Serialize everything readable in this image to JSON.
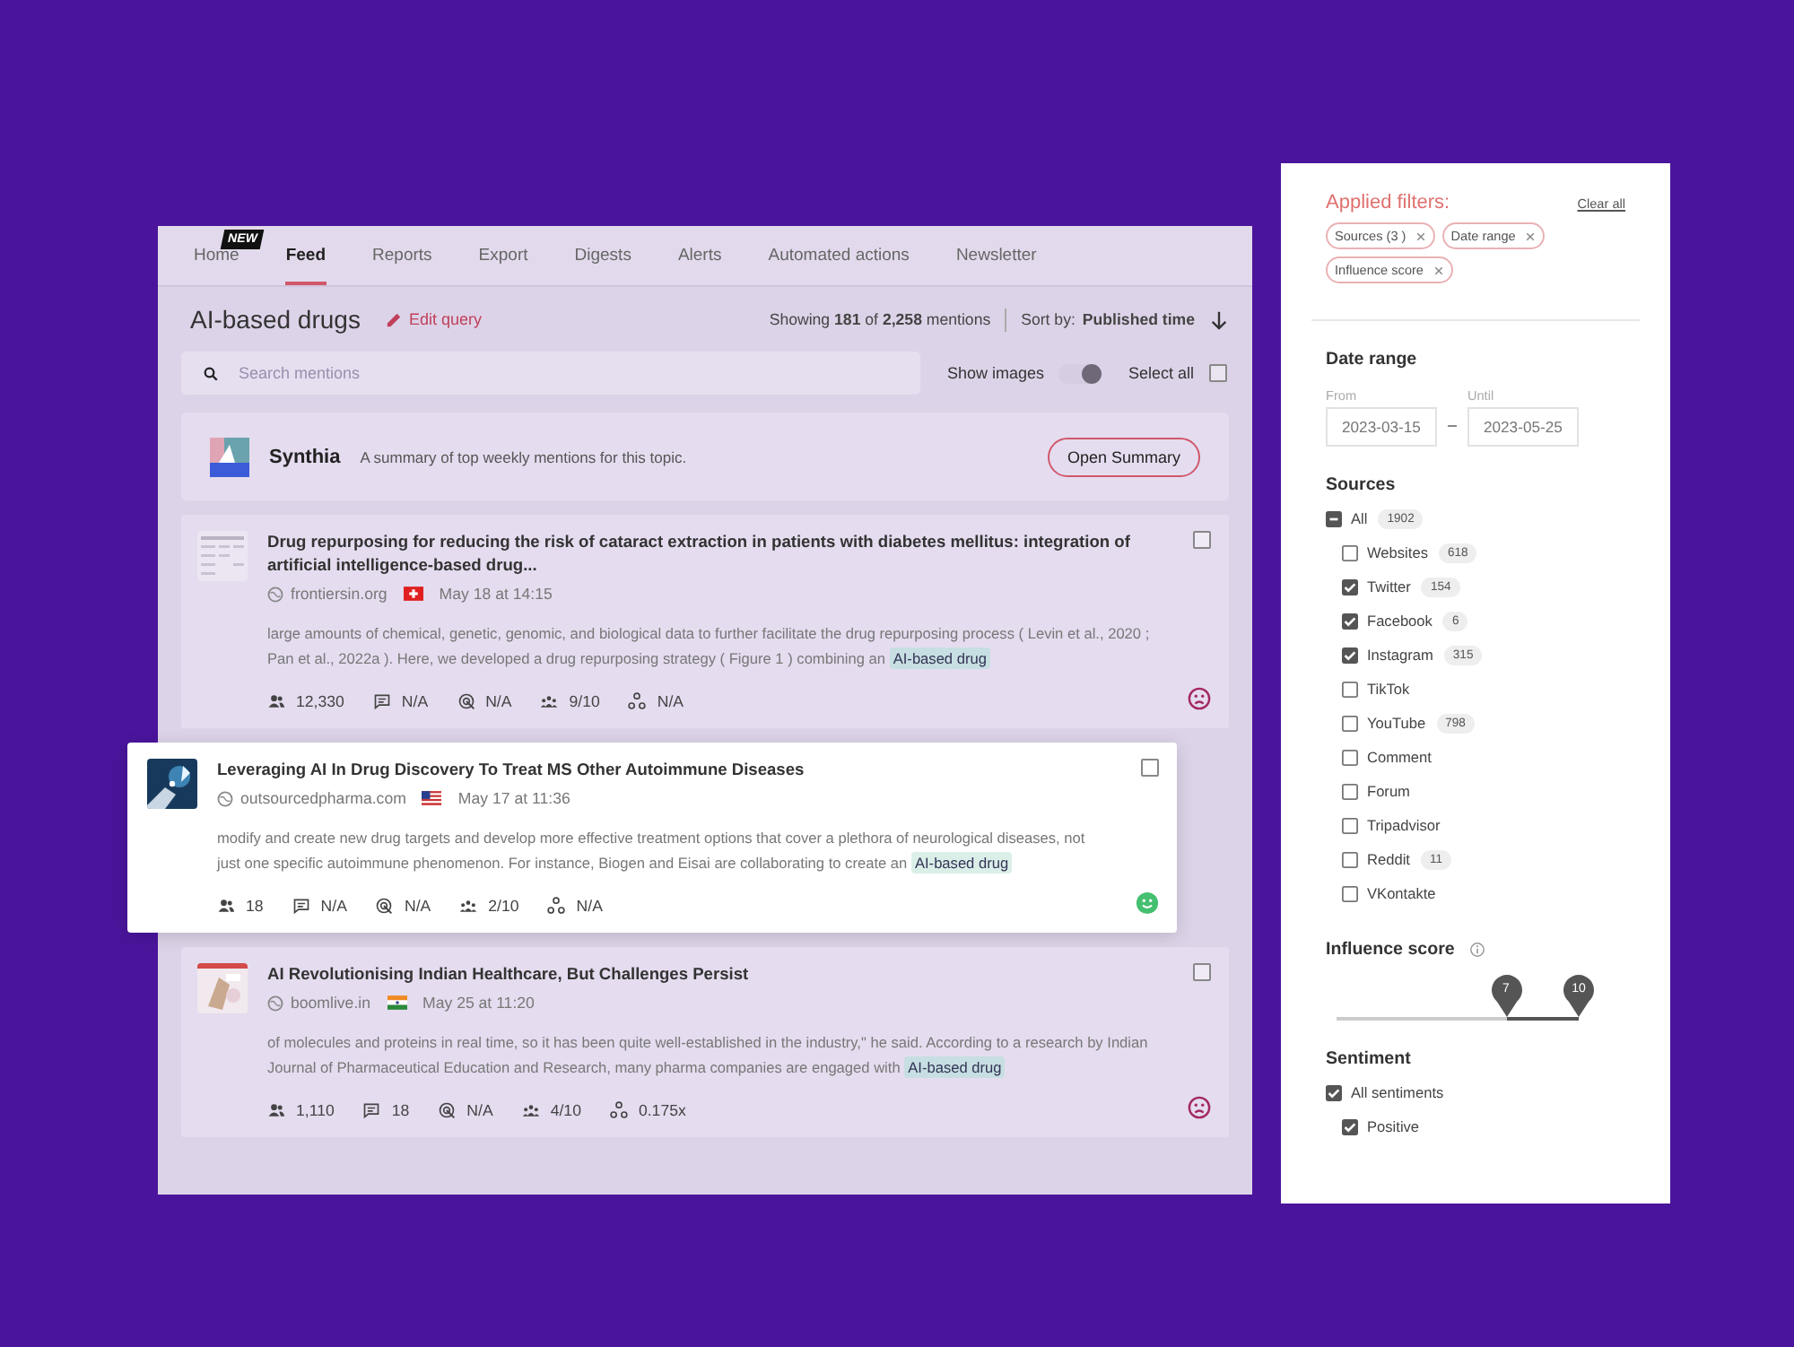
{
  "tabs": [
    {
      "label": "Home",
      "selected": false,
      "badge": "NEW"
    },
    {
      "label": "Feed",
      "selected": true
    },
    {
      "label": "Reports",
      "selected": false
    },
    {
      "label": "Export",
      "selected": false
    },
    {
      "label": "Digests",
      "selected": false
    },
    {
      "label": "Alerts",
      "selected": false
    },
    {
      "label": "Automated actions",
      "selected": false
    },
    {
      "label": "Newsletter",
      "selected": false
    }
  ],
  "header": {
    "title": "AI-based drugs",
    "edit": "Edit query",
    "showing": "Showing **181** of **2,258** mentions",
    "sort_label": "Sort by:",
    "sort_value": "Published time"
  },
  "toolbar": {
    "search_placeholder": "Search mentions",
    "show_images": {
      "label": "Show images",
      "on": true
    },
    "select_all": {
      "label": "Select all",
      "checked": false
    }
  },
  "summary": {
    "name": "Synthia",
    "text": "A summary of top weekly mentions for this topic.",
    "button": "Open Summary"
  },
  "mentions": [
    {
      "title": "Drug repurposing for reducing the risk of cataract extraction in patients with diabetes mellitus: integration of artificial intelligence-based drug...",
      "source": "frontiersin.org",
      "flag": {
        "kind": "ch"
      },
      "date": "May 18 at 14:15",
      "snippet": "large amounts of chemical, genetic, genomic, and biological data to further facilitate the drug repurposing process ( Levin et al., 2020 ; Pan et al., 2022a ). Here, we developed a drug repurposing strategy ( Figure 1 ) combining an",
      "highlight": "AI-based drug",
      "stats": [
        {
          "kind": "audience",
          "value": "12,330"
        },
        {
          "kind": "comments",
          "value": "N/A"
        },
        {
          "kind": "reach",
          "value": "N/A"
        },
        {
          "kind": "score",
          "value": "9/10"
        },
        {
          "kind": "virality",
          "value": "N/A"
        }
      ],
      "sentiment": {
        "kind": "negative"
      },
      "checked": false,
      "focused": false
    },
    {
      "title": "Leveraging AI In Drug Discovery To Treat MS Other Autoimmune Diseases",
      "source": "outsourcedpharma.com",
      "flag": {
        "kind": "us"
      },
      "date": "May 17 at 11:36",
      "snippet": "modify and create new drug targets and develop more effective treatment options that cover a plethora of neurological diseases, not just one specific autoimmune phenomenon. For instance, Biogen and Eisai are collaborating to create an",
      "highlight": "AI-based drug",
      "stats": [
        {
          "kind": "audience",
          "value": "18"
        },
        {
          "kind": "comments",
          "value": "N/A"
        },
        {
          "kind": "reach",
          "value": "N/A"
        },
        {
          "kind": "score",
          "value": "2/10"
        },
        {
          "kind": "virality",
          "value": "N/A"
        }
      ],
      "sentiment": {
        "kind": "positive"
      },
      "checked": false,
      "focused": true
    },
    {
      "title": "AI Revolutionising Indian Healthcare, But Challenges Persist",
      "source": "boomlive.in",
      "flag": {
        "kind": "in"
      },
      "date": "May 25 at 11:20",
      "snippet": "of molecules and proteins in real time, so it has been quite well-established in the industry,\" he said. According to a research by Indian Journal of Pharmaceutical Education and Research, many pharma companies are engaged with",
      "highlight": "AI-based drug",
      "stats": [
        {
          "kind": "audience",
          "value": "1,110"
        },
        {
          "kind": "comments",
          "value": "18"
        },
        {
          "kind": "reach",
          "value": "N/A"
        },
        {
          "kind": "score",
          "value": "4/10"
        },
        {
          "kind": "virality",
          "value": "0.175x"
        }
      ],
      "sentiment": {
        "kind": "negative"
      },
      "checked": false,
      "focused": false
    }
  ],
  "filters": {
    "title": "Applied filters:",
    "clear": "Clear all",
    "chips": [
      "Sources (3 )",
      "Date range",
      "Influence score"
    ],
    "date_range": {
      "title": "Date range",
      "from_label": "From",
      "from": "2023-03-15",
      "until_label": "Until",
      "until": "2023-05-25"
    },
    "sources": {
      "title": "Sources",
      "all": {
        "label": "All",
        "count": "1902",
        "indeterminate": true
      },
      "items": [
        {
          "label": "Websites",
          "count": "618",
          "checked": false
        },
        {
          "label": "Twitter",
          "count": "154",
          "checked": true
        },
        {
          "label": "Facebook",
          "count": "6",
          "checked": true
        },
        {
          "label": "Instagram",
          "count": "315",
          "checked": true
        },
        {
          "label": "TikTok",
          "checked": false
        },
        {
          "label": "YouTube",
          "count": "798",
          "checked": false
        },
        {
          "label": "Comment",
          "checked": false
        },
        {
          "label": "Forum",
          "checked": false
        },
        {
          "label": "Tripadvisor",
          "checked": false
        },
        {
          "label": "Reddit",
          "count": "11",
          "checked": false
        },
        {
          "label": "VKontakte",
          "checked": false
        }
      ]
    },
    "influence": {
      "title": "Influence score",
      "handles": [
        {
          "label": "7",
          "level": 0.7
        },
        {
          "label": "10",
          "level": 1
        }
      ]
    },
    "sentiment": {
      "title": "Sentiment",
      "items": [
        {
          "label": "All sentiments",
          "checked": true,
          "children": [
            {
              "label": "Positive",
              "checked": true
            }
          ]
        }
      ]
    }
  }
}
